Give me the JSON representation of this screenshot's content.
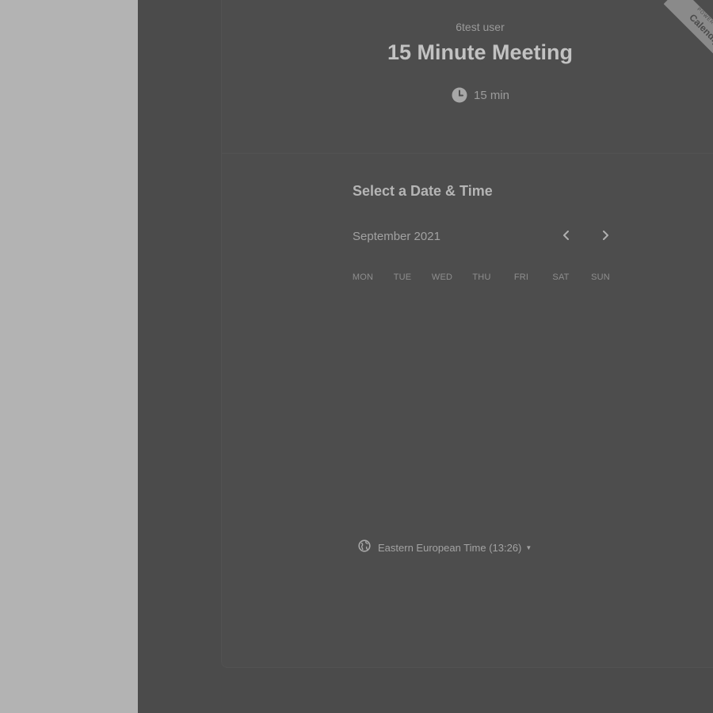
{
  "event": {
    "host_name": "6test user",
    "title": "15 Minute Meeting",
    "duration": "15 min"
  },
  "scheduler": {
    "section_title": "Select a Date & Time",
    "month_label": "September 2021",
    "weekdays": [
      "MON",
      "TUE",
      "WED",
      "THU",
      "FRI",
      "SAT",
      "SUN"
    ],
    "timezone_label": "Eastern European Time (13:26)"
  },
  "ribbon": {
    "small_text": "POWERED BY",
    "brand_text": "Calendly"
  },
  "icons": {
    "duration": "clock-icon",
    "prev_month": "chevron-left-icon",
    "next_month": "chevron-right-icon",
    "timezone": "globe-icon",
    "timezone_dropdown": "caret-down-icon"
  },
  "colors": {
    "overlay_dark": "#4b4b4b",
    "overlay_light": "#b3b3b3"
  }
}
